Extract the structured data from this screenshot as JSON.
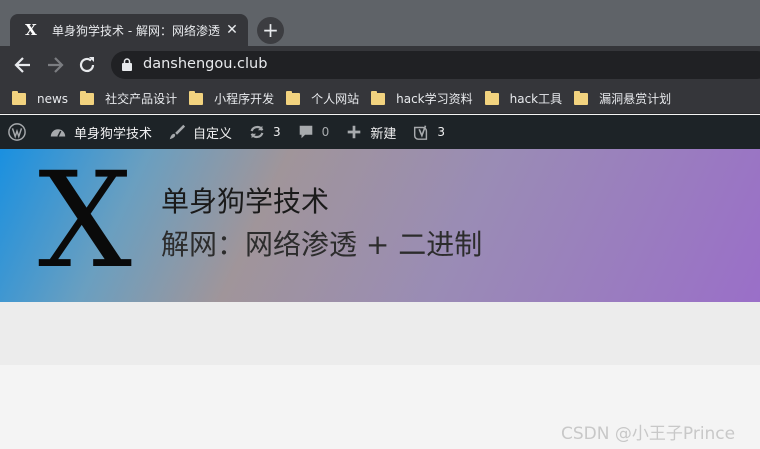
{
  "browser": {
    "tab": {
      "favicon": "X",
      "title": "单身狗学技术 - 解网：网络渗透 + 二进制",
      "close": "✕"
    },
    "new_tab": "+",
    "url": "danshengou.club",
    "bookmarks": [
      {
        "label": "news"
      },
      {
        "label": "社交产品设计"
      },
      {
        "label": "小程序开发"
      },
      {
        "label": "个人网站"
      },
      {
        "label": "hack学习资料"
      },
      {
        "label": "hack工具"
      },
      {
        "label": "漏洞悬赏计划"
      }
    ]
  },
  "admin_bar": {
    "site_name": "单身狗学技术",
    "customize": "自定义",
    "updates_count": "3",
    "comments_count": "0",
    "new_label": "新建",
    "yoast_count": "3"
  },
  "site": {
    "logo_letter": "X",
    "title": "单身狗学技术",
    "description": "解网：网络渗透 + 二进制"
  },
  "watermark": "CSDN @小王子Prince",
  "colors": {
    "tabstrip": "#5f6368",
    "toolbar": "#35363a",
    "adminbar": "#1d2327",
    "hero_start": "#1a90e0",
    "hero_end": "#9a6fc8"
  }
}
